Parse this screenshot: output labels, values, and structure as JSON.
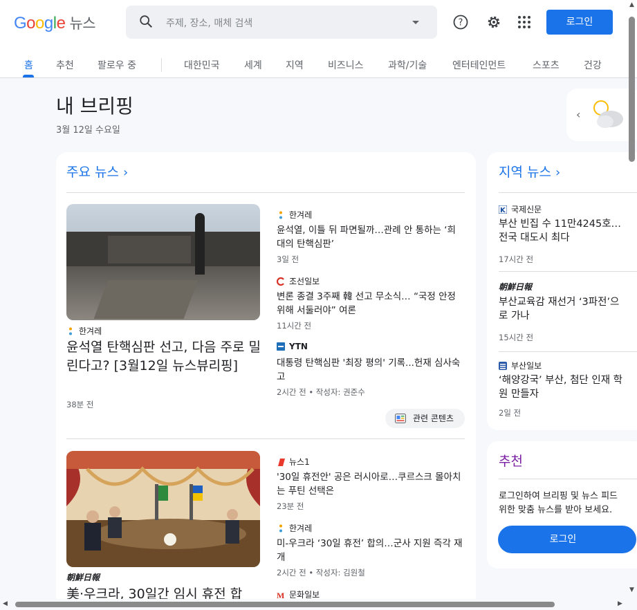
{
  "header": {
    "logo_text": "Google",
    "logo_product": "뉴스",
    "search_placeholder": "주제, 장소, 매체 검색",
    "login_label": "로그인"
  },
  "nav": {
    "tabs": [
      "홈",
      "추천",
      "팔로우 중",
      "대한민국",
      "세계",
      "지역",
      "비즈니스",
      "과학/기술",
      "엔터테인먼트",
      "스포츠",
      "건강"
    ]
  },
  "page": {
    "title": "내 브리핑",
    "date": "3월 12일 수요일"
  },
  "top_news": {
    "heading": "주요 뉴스",
    "story1": {
      "main": {
        "source": "한겨레",
        "headline": "윤석열 탄핵심판 선고, 다음 주로 밀린다고? [3월12일 뉴스뷰리핑]",
        "time": "38분 전"
      },
      "side": [
        {
          "source": "한겨레",
          "headline": "윤석열, 이틀 뒤 파면될까…관례 안 통하는 ‘희대의 탄핵심판’",
          "time": "3일 전"
        },
        {
          "source": "조선일보",
          "headline": "변론 종결 3주째 韓 선고 무소식… “국정 안정 위해 서둘러야” 여론",
          "time": "11시간 전"
        },
        {
          "source": "YTN",
          "headline": "대통령 탄핵심판 '최장 평의' 기록...헌재 심사숙고",
          "time": "2시간 전 • 작성자: 권준수"
        }
      ],
      "related_label": "관련 콘텐츠"
    },
    "story2": {
      "main": {
        "source": "朝鮮日報",
        "headline": "美·우크라, 30일간 임시 휴전 합"
      },
      "side": [
        {
          "source": "뉴스1",
          "headline": "'30일 휴전안' 공은 러시아로…쿠르스크 몰아치는 푸틴 선택은",
          "time": "23분 전"
        },
        {
          "source": "한겨레",
          "headline": "미-우크라 ‘30일 휴전’ 합의…군사 지원 즉각 재개",
          "time": "2시간 전 • 작성자: 김원철"
        },
        {
          "source": "문화일보"
        }
      ]
    }
  },
  "local_news": {
    "heading": "지역 뉴스",
    "items": [
      {
        "source": "국제신문",
        "headline": "부산 빈집 수 11만4245호… 전국 대도시 최다",
        "time": "17시간 전"
      },
      {
        "source": "朝鮮日報",
        "headline": "부산교육감 재선거 ‘3파전’으로 가나",
        "time": "15시간 전"
      },
      {
        "source": "부산일보",
        "headline": "‘해양강국’ 부산, 첨단 인재 학원 만들자",
        "time": "2일 전"
      }
    ]
  },
  "recommended": {
    "heading": "추천",
    "text_line1": "로그인하여 브리핑 및 뉴스 피드",
    "text_line2": "위한 맞춤 뉴스를 받아 보세요.",
    "button_label": "로그인"
  },
  "colors": {
    "accent": "#1a73e8",
    "background": "#f6f8fc",
    "card": "#ffffff"
  }
}
